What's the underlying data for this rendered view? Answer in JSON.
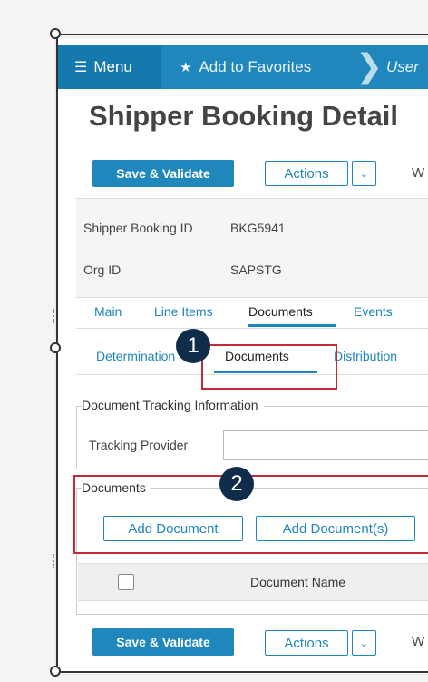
{
  "nav": {
    "menu_icon": "☰",
    "menu_label": "Menu",
    "favorites_icon": "★",
    "favorites_label": "Add to Favorites",
    "separator": "❯",
    "user_label": "User"
  },
  "page": {
    "title": "Shipper Booking Detail"
  },
  "toolbar": {
    "save_label": "Save & Validate",
    "actions_label": "Actions",
    "dropdown_icon": "⌄",
    "trailing_text": "W"
  },
  "info": {
    "booking_id_label": "Shipper Booking ID",
    "booking_id_value": "BKG5941",
    "org_id_label": "Org ID",
    "org_id_value": "SAPSTG"
  },
  "tabs": [
    "Main",
    "Line Items",
    "Documents",
    "Events"
  ],
  "subtabs": [
    "Determination",
    "Documents",
    "Distribution"
  ],
  "tracking": {
    "legend": "Document Tracking Information",
    "provider_label": "Tracking Provider",
    "provider_value": ""
  },
  "documents": {
    "legend": "Documents",
    "add_document_label": "Add Document",
    "add_documents_label": "Add Document(s)",
    "column_name": "Document Name"
  },
  "bottom_toolbar": {
    "save_label": "Save & Validate",
    "actions_label": "Actions",
    "dropdown_icon": "⌄",
    "trailing_text": "W"
  },
  "callouts": {
    "one": "1",
    "two": "2"
  },
  "colors": {
    "accent": "#1f87bb",
    "callout_border": "#c22a35",
    "badge": "#0f2d4a"
  }
}
